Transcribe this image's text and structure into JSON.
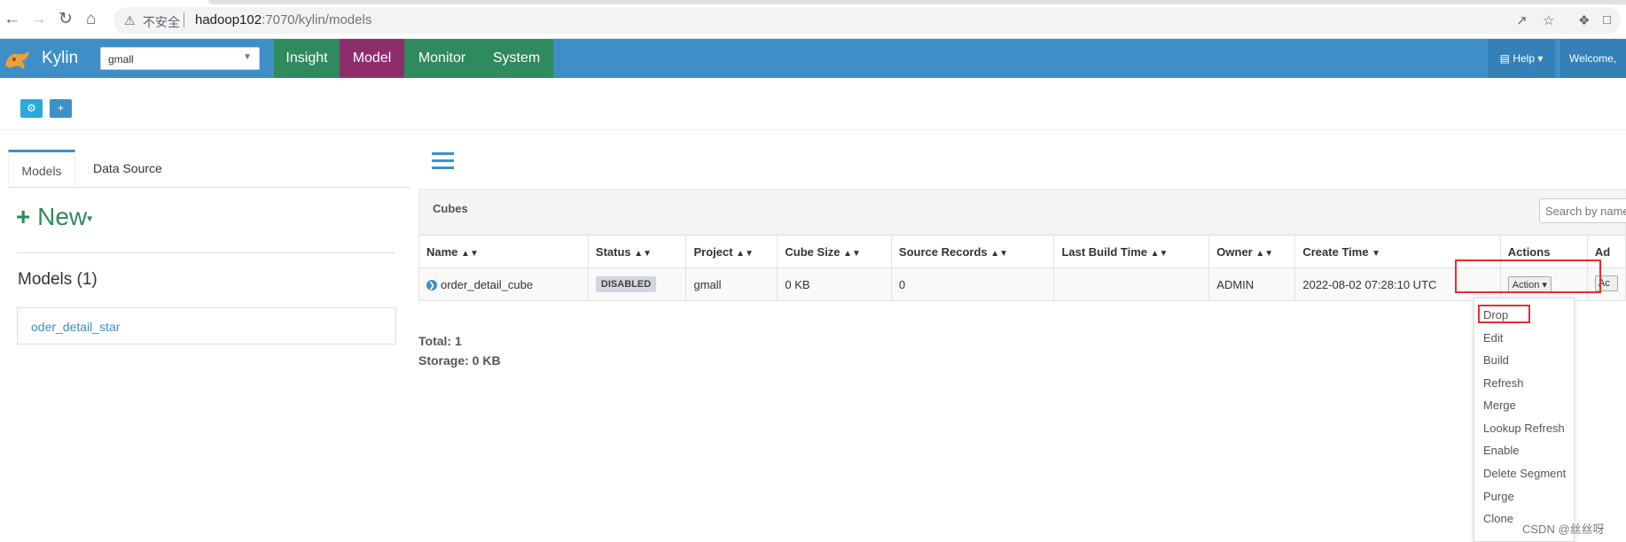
{
  "browser": {
    "security_label": "不安全",
    "url_host": "hadoop102",
    "url_path": ":7070/kylin/models"
  },
  "navbar": {
    "brand": "Kylin",
    "project": "gmall",
    "tabs": [
      {
        "label": "Insight",
        "color": "#2f8a5e"
      },
      {
        "label": "Model",
        "color": "#8e2d6c",
        "active": true
      },
      {
        "label": "Monitor",
        "color": "#2f8a5e"
      },
      {
        "label": "System",
        "color": "#2f8a5e"
      }
    ],
    "help": "Help",
    "welcome": "Welcome,"
  },
  "left": {
    "tabs": [
      "Models",
      "Data Source"
    ],
    "new_label": "New",
    "models_title": "Models (1)",
    "models": [
      "oder_detail_star"
    ]
  },
  "cubes": {
    "header": "Cubes",
    "search_placeholder": "Search by name",
    "columns": [
      "Name",
      "Status",
      "Project",
      "Cube Size",
      "Source Records",
      "Last Build Time",
      "Owner",
      "Create Time",
      "Actions",
      "Ad"
    ],
    "rows": [
      {
        "name": "order_detail_cube",
        "status": "DISABLED",
        "project": "gmall",
        "cube_size": "0 KB",
        "source_records": "0",
        "last_build_time": "",
        "owner": "ADMIN",
        "create_time": "2022-08-02 07:28:10 UTC",
        "action": "Action",
        "admin_action": "Ac"
      }
    ],
    "total": "Total: 1",
    "storage": "Storage: 0 KB"
  },
  "action_menu": [
    "Drop",
    "Edit",
    "Build",
    "Refresh",
    "Merge",
    "Lookup Refresh",
    "Enable",
    "Delete Segment",
    "Purge",
    "Clone"
  ],
  "watermark": "CSDN @丝丝呀",
  "colors": {
    "navbar": "#3e8fc7",
    "highlight": "#e52e2e",
    "new_button": "#2e8b57"
  }
}
